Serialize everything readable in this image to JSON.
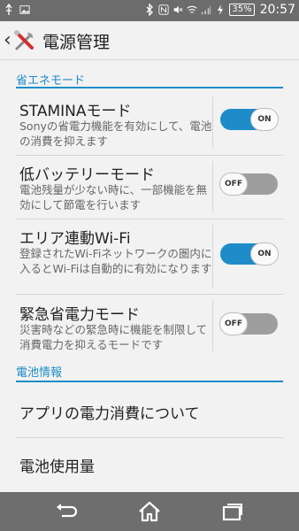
{
  "status_bar": {
    "battery": "35%",
    "time": "20:57"
  },
  "action_bar": {
    "title": "電源管理"
  },
  "sections": {
    "power_saving": "省エネモード",
    "battery_info": "電池情報"
  },
  "settings": [
    {
      "title": "STAMINAモード",
      "desc": "Sonyの省電力機能を有効にして、電池の消費を抑えます",
      "toggle": "ON",
      "enabled": true
    },
    {
      "title": "低バッテリーモード",
      "desc": "電池残量が少ない時に、一部機能を無効にして節電を行います",
      "toggle": "OFF",
      "enabled": false
    },
    {
      "title": "エリア連動Wi-Fi",
      "desc": "登録されたWi-Fiネットワークの圏内に入るとWi-Fiは自動的に有効になります",
      "toggle": "ON",
      "enabled": true
    },
    {
      "title": "緊急省電力モード",
      "desc": "災害時などの緊急時に機能を制限して消費電力を抑えるモードです",
      "toggle": "OFF",
      "enabled": false
    }
  ],
  "battery_items": [
    {
      "label": "アプリの電力消費について"
    },
    {
      "label": "電池使用量"
    }
  ],
  "colors": {
    "accent": "#1e8cc8",
    "status_bar": "#6c6c6c",
    "nav_bar": "#6e6e6e"
  }
}
